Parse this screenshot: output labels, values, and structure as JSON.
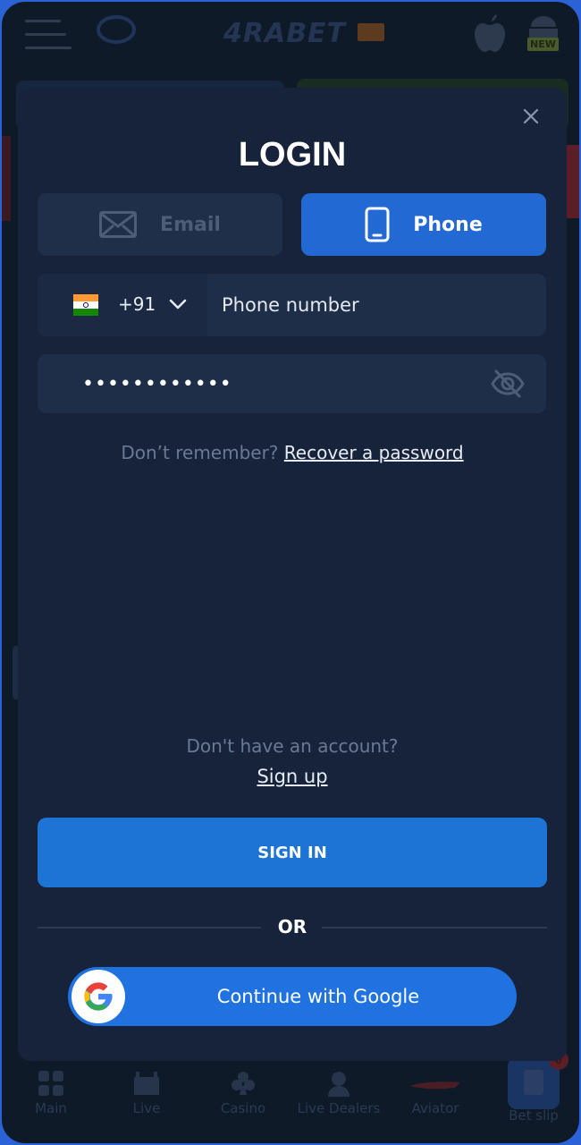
{
  "app": {
    "brand": "4RABET",
    "badge_new": "NEW"
  },
  "modal": {
    "title": "LOGIN",
    "tabs": [
      {
        "label": "Email",
        "icon": "envelope-icon",
        "active": false
      },
      {
        "label": "Phone",
        "icon": "smartphone-icon",
        "active": true
      }
    ],
    "phone": {
      "country_flag": "india-flag-icon",
      "dial_code": "+91",
      "placeholder": "Phone number"
    },
    "password": {
      "masked_value": "••••••••••••"
    },
    "recover": {
      "prefix": "Don’t remember?",
      "link": "Recover a password"
    },
    "signup": {
      "prompt": "Don't have an account?",
      "link": "Sign up"
    },
    "signin_label": "SIGN IN",
    "or_label": "OR",
    "google_label": "Continue with Google"
  },
  "bottom_nav": [
    {
      "label": "Main",
      "icon": "grid-icon"
    },
    {
      "label": "Live",
      "icon": "stadium-icon"
    },
    {
      "label": "Casino",
      "icon": "club-icon"
    },
    {
      "label": "Live Dealers",
      "icon": "dealer-icon"
    },
    {
      "label": "Aviator",
      "icon": "plane-icon"
    },
    {
      "label": "Bet slip",
      "icon": "ticket-icon",
      "count": "0"
    }
  ],
  "colors": {
    "accent": "#2269d3",
    "modal_bg": "#17233a",
    "field_bg": "#1f2e48"
  }
}
